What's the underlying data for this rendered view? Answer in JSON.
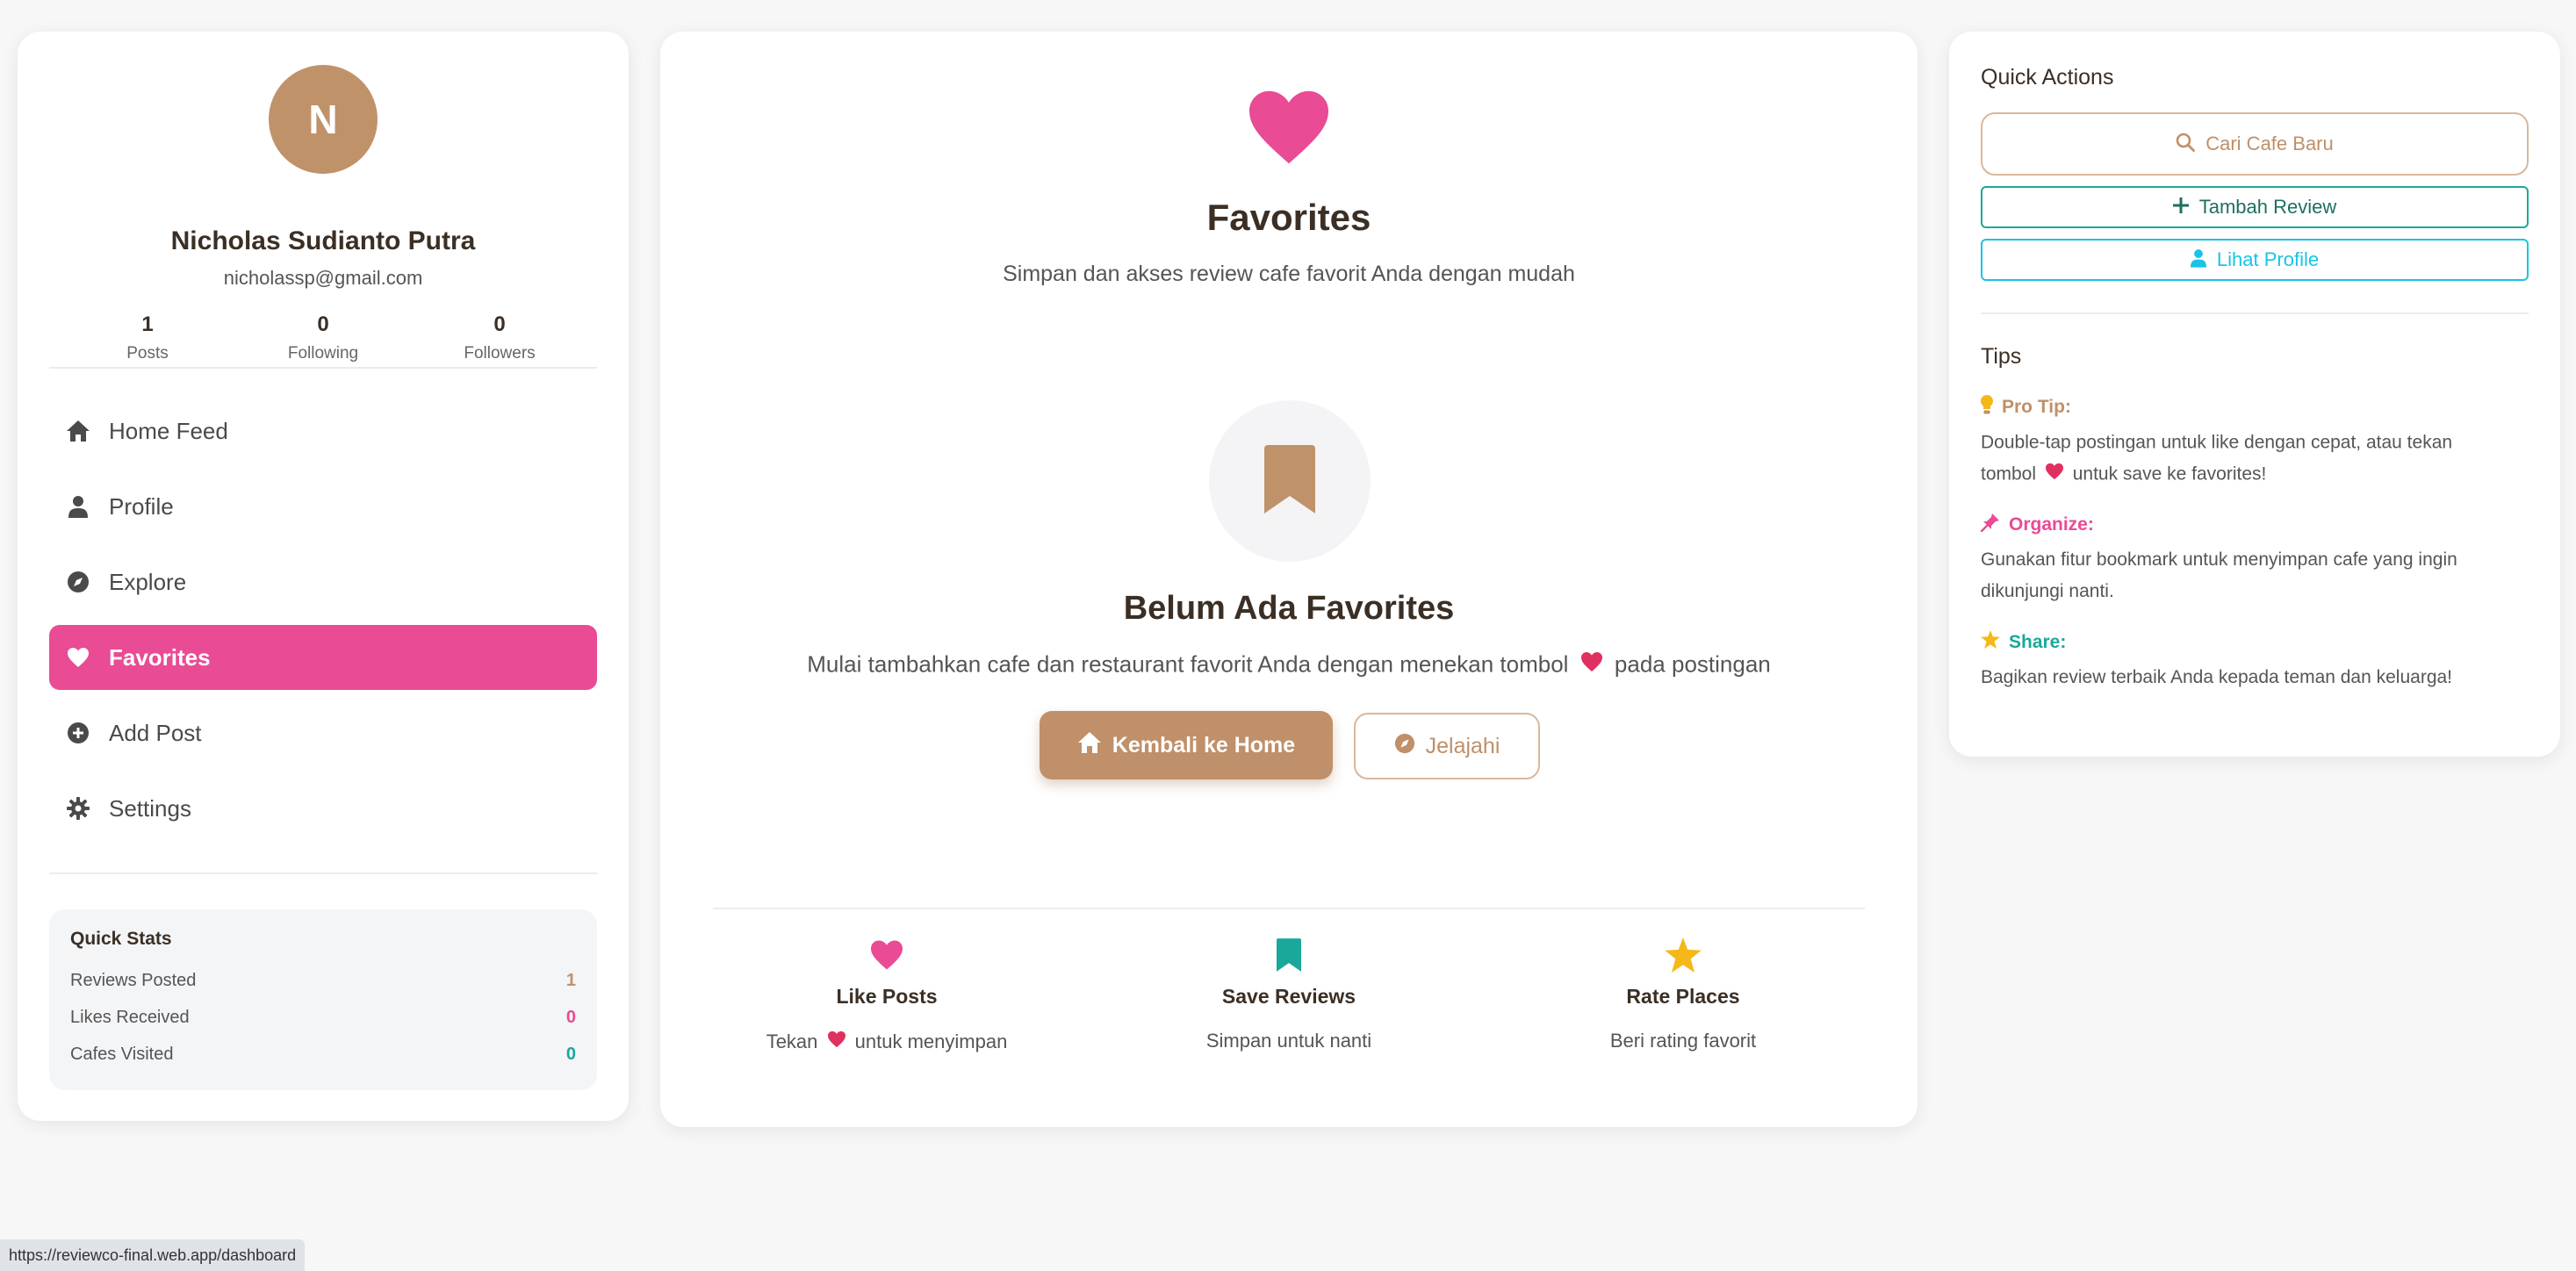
{
  "user": {
    "initial": "N",
    "name": "Nicholas Sudianto Putra",
    "email": "nicholassp@gmail.com",
    "stats": [
      {
        "value": "1",
        "label": "Posts"
      },
      {
        "value": "0",
        "label": "Following"
      },
      {
        "value": "0",
        "label": "Followers"
      }
    ]
  },
  "nav": [
    {
      "label": "Home Feed",
      "icon": "home-icon"
    },
    {
      "label": "Profile",
      "icon": "user-icon"
    },
    {
      "label": "Explore",
      "icon": "compass-icon"
    },
    {
      "label": "Favorites",
      "icon": "heart-icon",
      "active": true
    },
    {
      "label": "Add Post",
      "icon": "plus-circle-icon"
    },
    {
      "label": "Settings",
      "icon": "gear-icon"
    }
  ],
  "quick_stats": {
    "title": "Quick Stats",
    "rows": [
      {
        "label": "Reviews Posted",
        "value": "1",
        "color": "#c0926a"
      },
      {
        "label": "Likes Received",
        "value": "0",
        "color": "#e94b94"
      },
      {
        "label": "Cafes Visited",
        "value": "0",
        "color": "#1aa89a"
      }
    ]
  },
  "favorites": {
    "title": "Favorites",
    "subtitle": "Simpan dan akses review cafe favorit Anda dengan mudah",
    "empty_title": "Belum Ada Favorites",
    "empty_sub_before": "Mulai tambahkan cafe dan restaurant favorit Anda dengan menekan tombol",
    "empty_sub_after": "pada postingan",
    "home_button": "Kembali ke Home",
    "explore_button": "Jelajahi",
    "features": [
      {
        "title": "Like Posts",
        "desc_before": "Tekan",
        "desc_after": "untuk menyimpan",
        "icon": "heart-icon"
      },
      {
        "title": "Save Reviews",
        "desc": "Simpan untuk nanti",
        "icon": "bookmark-icon"
      },
      {
        "title": "Rate Places",
        "desc": "Beri rating favorit",
        "icon": "star-icon"
      }
    ]
  },
  "quick_actions": {
    "title": "Quick Actions",
    "search": "Cari Cafe Baru",
    "add_review": "Tambah Review",
    "view_profile": "Lihat Profile"
  },
  "tips": {
    "title": "Tips",
    "pro_tip_label": "Pro Tip:",
    "pro_tip_before": "Double-tap postingan untuk like dengan cepat, atau tekan tombol",
    "pro_tip_after": "untuk save ke favorites!",
    "organize_label": "Organize:",
    "organize_text": "Gunakan fitur bookmark untuk menyimpan cafe yang ingin dikunjungi nanti.",
    "share_label": "Share:",
    "share_text": "Bagikan review terbaik Anda kepada teman dan keluarga!"
  },
  "colors": {
    "brand": "#c0926a",
    "pink": "#e94b94",
    "teal": "#1aa89a",
    "cyan": "#19c3e6",
    "star": "#f5b819"
  },
  "status_url": "https://reviewco-final.web.app/dashboard"
}
